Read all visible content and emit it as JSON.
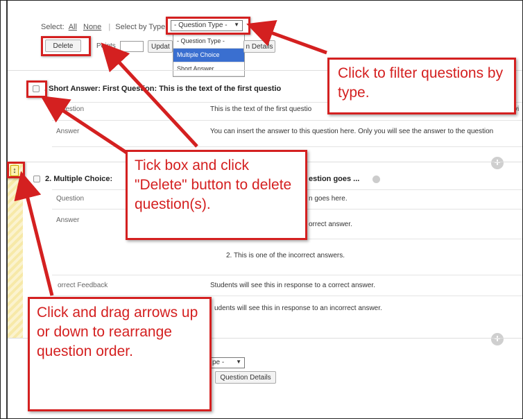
{
  "toolbar": {
    "select_label": "Select:",
    "all_link": "All",
    "none_link": "None",
    "select_by_type_label": "Select by Type",
    "question_type_value": "- Question Type -",
    "delete_button": "Delete",
    "points_label": "Points",
    "update_button": "Updat",
    "details_button": "n Details",
    "dropdown_options": [
      "- Question Type -",
      "Multiple Choice",
      "Short Answer"
    ]
  },
  "questions": [
    {
      "header": ". Short Answer: First Question: This is the text of the first questio",
      "rows": [
        {
          "label": "Question",
          "value": "This is the text of the first questio"
        },
        {
          "label": "Answer",
          "value": "You can insert the answer to this question here. Only you will see the answer to the question"
        }
      ],
      "extra_fragment": "vi"
    },
    {
      "header": "2. Multiple Choice:",
      "header_tail": "estion goes ...",
      "rows": [
        {
          "label": "Question",
          "value": "n goes here."
        },
        {
          "label": "Answer",
          "value": "orrect answer."
        },
        {
          "label": "",
          "value": "2. This is one of the incorrect answers."
        },
        {
          "label": "orrect Feedback",
          "value": "Students will see this in response to a correct answer."
        },
        {
          "label": "",
          "value": "udents will see this in response to an incorrect answer."
        }
      ]
    }
  ],
  "bottom_toolbar": {
    "question_type_value": "pe -",
    "details_button": "Question Details"
  },
  "callouts": {
    "filter": "Click to filter questions by type.",
    "delete": "Tick box and click \"Delete\" button to delete question(s).",
    "drag": "Click and drag arrows up or down to rearrange question order."
  },
  "icons": {
    "drag_handle": "↕",
    "add": "+",
    "dropdown_arrow": "▼"
  },
  "colors": {
    "callout_red": "#d42020",
    "dropdown_selected": "#3a6fd0",
    "drag_stripe": "#f7e9a8"
  }
}
